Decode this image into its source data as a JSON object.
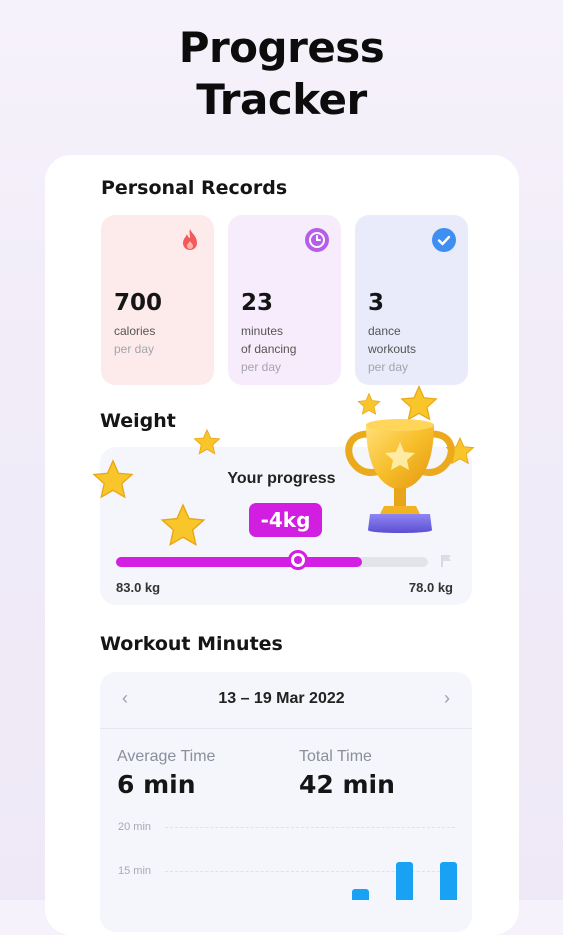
{
  "page": {
    "title_line1": "Progress",
    "title_line2": "Tracker"
  },
  "records": {
    "heading": "Personal Records",
    "items": [
      {
        "value": "700",
        "line1": "calories",
        "line2": "per day",
        "line3": "",
        "icon": "flame-icon",
        "bg": "#fdebec",
        "accent": "#f35a5a"
      },
      {
        "value": "23",
        "line1": "minutes",
        "line2": "of dancing",
        "line3": "per day",
        "icon": "clock-icon",
        "bg": "#f7ecfb",
        "accent": "#b65ee8"
      },
      {
        "value": "3",
        "line1": "dance",
        "line2": "workouts",
        "line3": "per day",
        "icon": "check-icon",
        "bg": "#e9ebfb",
        "accent": "#3f8ff2"
      }
    ]
  },
  "weight": {
    "heading": "Weight",
    "progress_label": "Your progress",
    "change": "-4kg",
    "start": "83.0 kg",
    "goal": "78.0 kg",
    "progress_fraction": 0.79
  },
  "workout": {
    "heading": "Workout Minutes",
    "week": "13 – 19 Mar 2022",
    "prev_icon": "chevron-left-icon",
    "next_icon": "chevron-right-icon",
    "avg_label": "Average Time",
    "avg_value": "6 min",
    "total_label": "Total Time",
    "total_value": "42 min",
    "ticks": [
      "20 min",
      "15 min"
    ]
  },
  "chart_data": {
    "type": "bar",
    "ylim": [
      0,
      20
    ],
    "values": [
      0,
      0,
      0,
      1,
      13,
      16,
      16
    ]
  },
  "colors": {
    "accent": "#d31ee3",
    "bar": "#19a2f4"
  }
}
